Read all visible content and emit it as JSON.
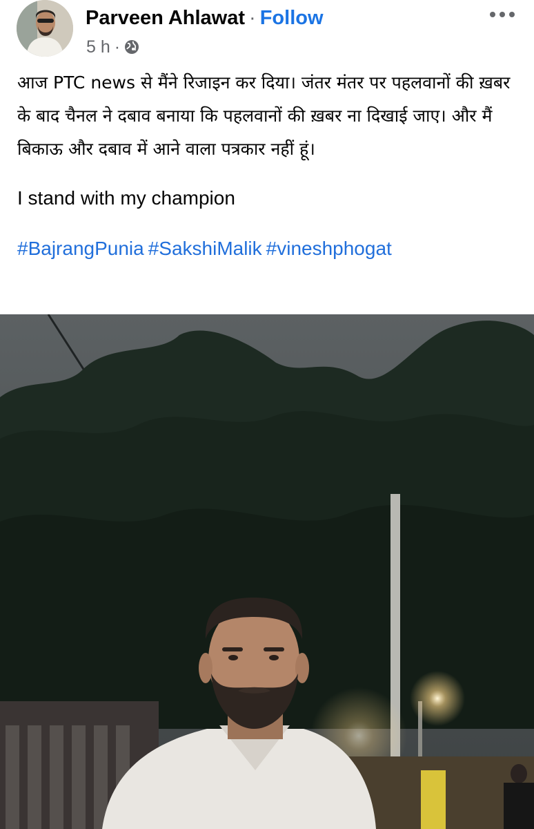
{
  "post": {
    "author_name": "Parveen Ahlawat",
    "separator": "·",
    "follow_label": "Follow",
    "timestamp": "5 h",
    "meta_separator": "·",
    "privacy_icon": "globe-icon",
    "more_icon": "more-options-icon",
    "text_hindi": "आज PTC news से मैंने रिजाइन कर दिया। जंतर मंतर पर पहलवानों की ख़बर के बाद चैनल ने दबाव बनाया कि पहलवानों की ख़बर ना दिखाई जाए। और मैं बिकाऊ और दबाव में आने वाला पत्रकार नहीं हूं।",
    "text_english": "I stand with my champion",
    "hashtags": [
      "#BajrangPunia",
      "#SakshiMalik",
      "#vineshphogat"
    ]
  },
  "colors": {
    "follow": "#1b74e4",
    "hashtag": "#216fdb",
    "secondary_text": "#65676b",
    "primary_text": "#050505"
  }
}
